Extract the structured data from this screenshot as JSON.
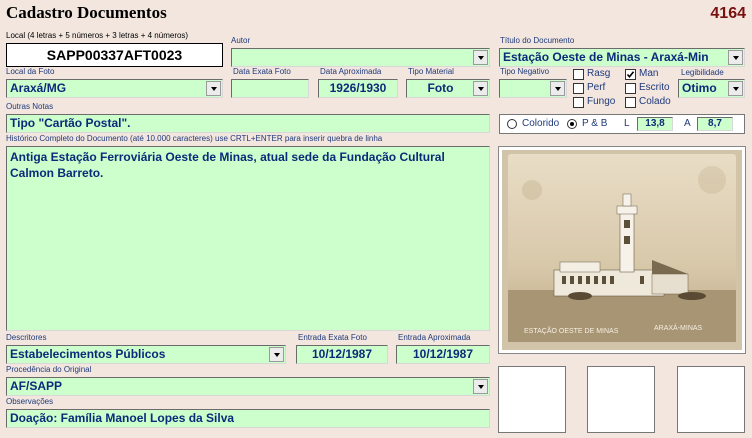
{
  "header": {
    "title": "Cadastro Documentos",
    "record_number": "4164"
  },
  "local": {
    "label": "Local (4 letras + 5 números + 3 letras + 4 números)",
    "value": "SAPP00337AFT0023"
  },
  "autor": {
    "label": "Autor",
    "value": ""
  },
  "titulo": {
    "label": "Título do Documento",
    "value": "Estação Oeste de Minas - Araxá-Min"
  },
  "local_foto": {
    "label": "Local da Foto",
    "value": "Araxá/MG"
  },
  "data_exata": {
    "label": "Data Exata Foto",
    "value": ""
  },
  "data_aprox": {
    "label": "Data Aproximada",
    "value": "1926/1930"
  },
  "tipo_material": {
    "label": "Tipo Material",
    "value": "Foto"
  },
  "tipo_negativo": {
    "label": "Tipo Negativo",
    "value": ""
  },
  "checkboxes": {
    "rasg": {
      "label": "Rasg",
      "checked": false
    },
    "perf": {
      "label": "Perf",
      "checked": false
    },
    "fungo": {
      "label": "Fungo",
      "checked": false
    },
    "man": {
      "label": "Man",
      "checked": true
    },
    "escrito": {
      "label": "Escrito",
      "checked": false
    },
    "colado": {
      "label": "Colado",
      "checked": false
    }
  },
  "legibilidade": {
    "label": "Legibilidade",
    "value": "Otimo"
  },
  "outras_notas": {
    "label": "Outras Notas",
    "value": "Tipo \"Cartão Postal\"."
  },
  "color_mode": {
    "colorido_label": "Colorido",
    "pb_label": "P & B",
    "selected": "pb",
    "l_label": "L",
    "l_value": "13,8",
    "a_label": "A",
    "a_value": "8,7"
  },
  "historico": {
    "label": "Histórico Completo do Documento (até 10.000 caracteres) use CRTL+ENTER para inserir quebra de linha",
    "value": "Antiga Estação Ferroviária Oeste de Minas, atual sede da Fundação Cultural Calmon Barreto."
  },
  "photo": {
    "caption_left": "ESTAÇÃO OESTE DE MINAS",
    "caption_right": "ARAXÁ-MINAS"
  },
  "descritores": {
    "label": "Descritores",
    "value": "Estabelecimentos Públicos"
  },
  "entrada_exata": {
    "label": "Entrada Exata Foto",
    "value": "10/12/1987"
  },
  "entrada_aprox": {
    "label": "Entrada Aproximada",
    "value": "10/12/1987"
  },
  "procedencia": {
    "label": "Procedência do Original",
    "value": "AF/SAPP"
  },
  "observacoes": {
    "label": "Observações",
    "value": "Doação: Família Manoel Lopes da Silva"
  }
}
